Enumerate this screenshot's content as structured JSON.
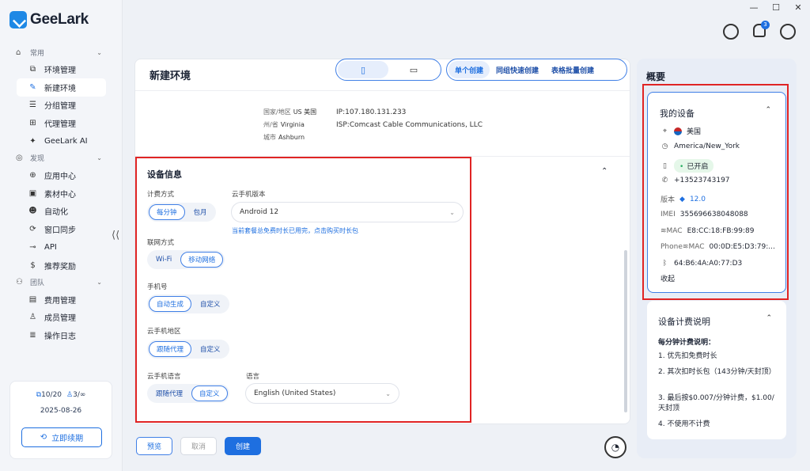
{
  "app": {
    "name": "GeeLark"
  },
  "window": {
    "minimize": "—",
    "maximize": "☐",
    "close": "✕"
  },
  "sidebar": {
    "groups": [
      {
        "label": "常用",
        "items": [
          {
            "label": "环境管理",
            "icon": "window-icon"
          },
          {
            "label": "新建环境",
            "icon": "edit-icon",
            "active": true
          },
          {
            "label": "分组管理",
            "icon": "list-icon"
          },
          {
            "label": "代理管理",
            "icon": "network-icon"
          },
          {
            "label": "GeeLark AI",
            "icon": "ai-icon"
          }
        ]
      },
      {
        "label": "发现",
        "items": [
          {
            "label": "应用中心",
            "icon": "app-center-icon"
          },
          {
            "label": "素材中心",
            "icon": "material-icon"
          },
          {
            "label": "自动化",
            "icon": "robot-icon"
          },
          {
            "label": "窗口同步",
            "icon": "sync-icon"
          },
          {
            "label": "API",
            "icon": "api-icon"
          },
          {
            "label": "推荐奖励",
            "icon": "reward-icon"
          }
        ]
      },
      {
        "label": "团队",
        "items": [
          {
            "label": "费用管理",
            "icon": "billing-icon"
          },
          {
            "label": "成员管理",
            "icon": "member-icon"
          },
          {
            "label": "操作日志",
            "icon": "log-icon"
          }
        ]
      }
    ],
    "collapse": "⟨⟨",
    "account": {
      "devices": "10/20",
      "members": "3/∞",
      "date": "2025-08-26",
      "renew": "立即续期"
    }
  },
  "main": {
    "title": "新建环境",
    "create_tabs": [
      "单个创建",
      "同组快速创建",
      "表格批量创建"
    ],
    "network": {
      "country_label": "国家/地区",
      "country": "US 美国",
      "state_label": "州/省",
      "state": "Virginia",
      "city_label": "城市",
      "city": "Ashburn",
      "ip": "IP:107.180.131.233",
      "isp": "ISP:Comcast Cable Communications, LLC"
    },
    "device_info": {
      "title": "设备信息",
      "billing_label": "计费方式",
      "billing_options": [
        "每分钟",
        "包月"
      ],
      "version_label": "云手机版本",
      "version_value": "Android 12",
      "version_hint": "当前套餐总免费时长已用完，点击购买时长包",
      "net_label": "联网方式",
      "net_options": [
        "Wi-Fi",
        "移动网络"
      ],
      "phone_label": "手机号",
      "phone_options": [
        "自动生成",
        "自定义"
      ],
      "region_label": "云手机地区",
      "region_options": [
        "跟随代理",
        "自定义"
      ],
      "lang_label": "云手机语言",
      "lang_options": [
        "跟随代理",
        "自定义"
      ],
      "language_label": "语言",
      "language_value": "English (United States)"
    },
    "buttons": {
      "preview": "预览",
      "cancel": "取消",
      "create": "创建"
    }
  },
  "overview": {
    "title": "概要",
    "my_device": {
      "title": "我的设备",
      "country": "美国",
      "timezone": "America/New_York",
      "status": "已开启",
      "phone": "+13523743197",
      "version_label": "版本",
      "version": "12.0",
      "imei_label": "IMEI",
      "imei": "355696638048088",
      "mac_label": "MAC",
      "mac": "E8:CC:18:FB:99:89",
      "phone_mac_label": "Phone",
      "phone_mac_label2": "MAC",
      "phone_mac": "00:0D:E5:D3:79:...",
      "bt": "64:B6:4A:A0:77:D3",
      "collapse": "收起"
    },
    "billing": {
      "title": "设备计费说明",
      "subtitle": "每分钟计费说明：",
      "lines": [
        "1. 优先扣免费时长",
        "2. 其次扣时长包（143分钟/天封顶）",
        "3. 最后按$0.007/分钟计费，$1.00/天封顶",
        "4. 不使用不计费"
      ]
    }
  },
  "notifications": {
    "count": "3"
  },
  "colors": {
    "accent": "#1e6fe0",
    "highlight": "#e02424"
  }
}
